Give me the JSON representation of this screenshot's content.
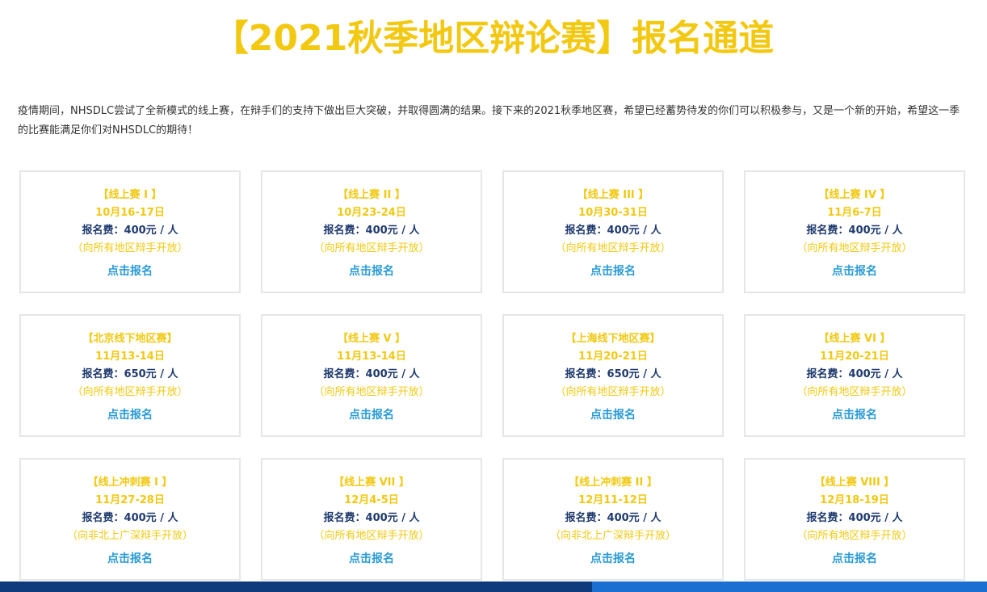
{
  "title": "【2021秋季地区辩论赛】报名通道",
  "intro": "疫情期间，NHSDLC尝试了全新模式的线上赛，在辩手们的支持下做出巨大突破，并取得圆满的结果。接下来的2021秋季地区赛，希望已经蓄势待发的你们可以积极参与，又是一个新的开始，希望这一季的比赛能满足你们对NHSDLC的期待！",
  "colors": {
    "accent": "#f2c811",
    "fee_text": "#1f3a6e",
    "link": "#2a9bd6",
    "bar_dark": "#0f3b7c",
    "bar_light": "#1a6fd0",
    "card_border": "#e6e6e6"
  },
  "cards": [
    {
      "name": "【线上赛 I 】",
      "date": "10月16-17日",
      "fee": "报名费：400元 / 人",
      "scope": "（向所有地区辩手开放）",
      "link": "点击报名"
    },
    {
      "name": "【线上赛 II 】",
      "date": "10月23-24日",
      "fee": "报名费：400元 / 人",
      "scope": "（向所有地区辩手开放）",
      "link": "点击报名"
    },
    {
      "name": "【线上赛 III 】",
      "date": "10月30-31日",
      "fee": "报名费：400元 / 人",
      "scope": "（向所有地区辩手开放）",
      "link": "点击报名"
    },
    {
      "name": "【线上赛 IV 】",
      "date": "11月6-7日",
      "fee": "报名费：400元 / 人",
      "scope": "（向所有地区辩手开放）",
      "link": "点击报名"
    },
    {
      "name": "【北京线下地区赛】",
      "date": "11月13-14日",
      "fee": "报名费：650元 / 人",
      "scope": "（向所有地区辩手开放）",
      "link": "点击报名"
    },
    {
      "name": "【线上赛 V 】",
      "date": "11月13-14日",
      "fee": "报名费：400元 / 人",
      "scope": "（向所有地区辩手开放）",
      "link": "点击报名"
    },
    {
      "name": "【上海线下地区赛】",
      "date": "11月20-21日",
      "fee": "报名费：650元 / 人",
      "scope": "（向所有地区辩手开放）",
      "link": "点击报名"
    },
    {
      "name": "【线上赛 VI 】",
      "date": "11月20-21日",
      "fee": "报名费：400元 / 人",
      "scope": "（向所有地区辩手开放）",
      "link": "点击报名"
    },
    {
      "name": "【线上冲刺赛 I 】",
      "date": "11月27-28日",
      "fee": "报名费：400元 / 人",
      "scope": "（向非北上广深辩手开放）",
      "link": "点击报名"
    },
    {
      "name": "【线上赛 VII 】",
      "date": "12月4-5日",
      "fee": "报名费：400元 / 人",
      "scope": "（向所有地区辩手开放）",
      "link": "点击报名"
    },
    {
      "name": "【线上冲刺赛 II 】",
      "date": "12月11-12日",
      "fee": "报名费：400元 / 人",
      "scope": "（向非北上广深辩手开放）",
      "link": "点击报名"
    },
    {
      "name": "【线上赛 VIII 】",
      "date": "12月18-19日",
      "fee": "报名费：400元 / 人",
      "scope": "（向所有地区辩手开放）",
      "link": "点击报名"
    }
  ]
}
